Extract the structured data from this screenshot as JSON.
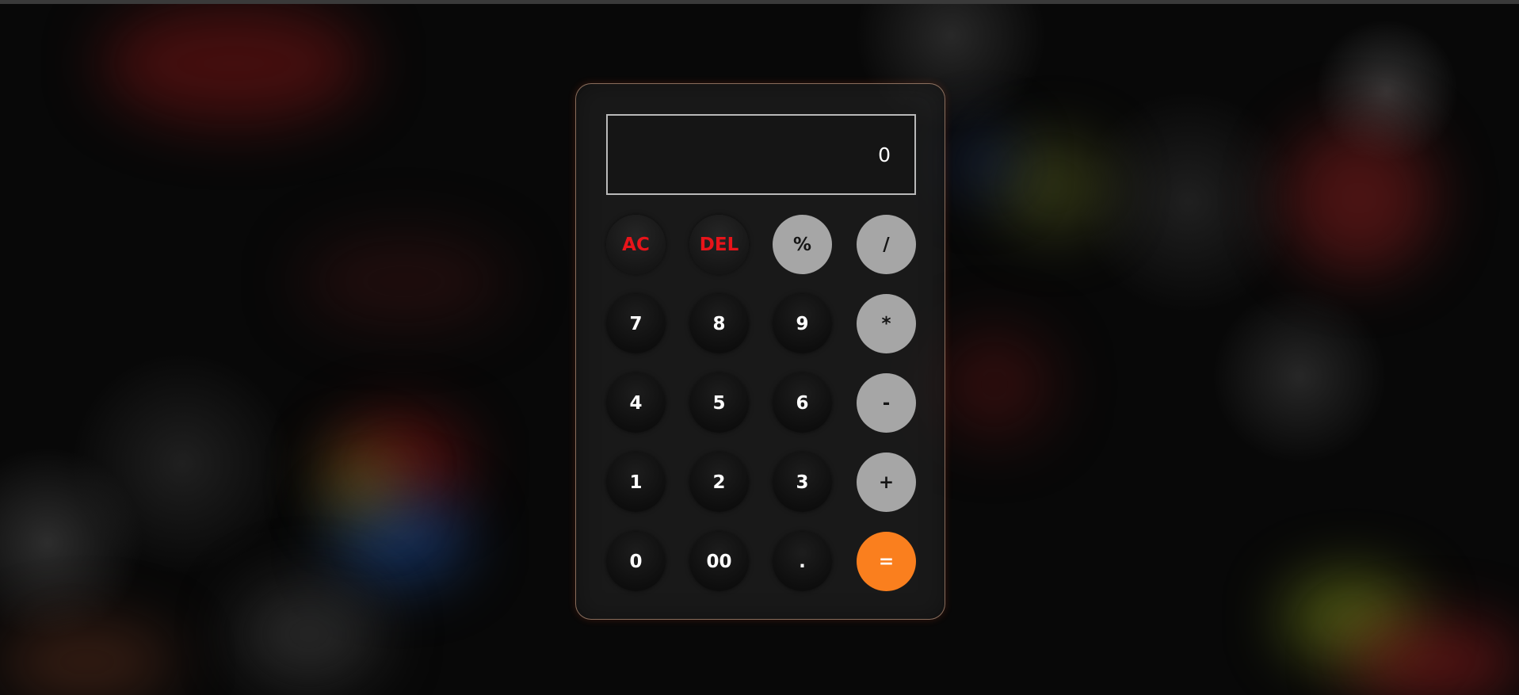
{
  "display": {
    "value": "0"
  },
  "keys": {
    "ac": "AC",
    "del": "DEL",
    "percent": "%",
    "divide": "/",
    "seven": "7",
    "eight": "8",
    "nine": "9",
    "multiply": "*",
    "four": "4",
    "five": "5",
    "six": "6",
    "subtract": "-",
    "one": "1",
    "two": "2",
    "three": "3",
    "add": "+",
    "zero": "0",
    "double_zero": "00",
    "decimal": ".",
    "equals": "="
  },
  "colors": {
    "function_key_text": "#e8141a",
    "operator_key_bg": "#a6a6a6",
    "equals_key_bg": "#fa7f1e",
    "digit_key_bg": "#151515",
    "display_border": "#b9b9b9"
  }
}
